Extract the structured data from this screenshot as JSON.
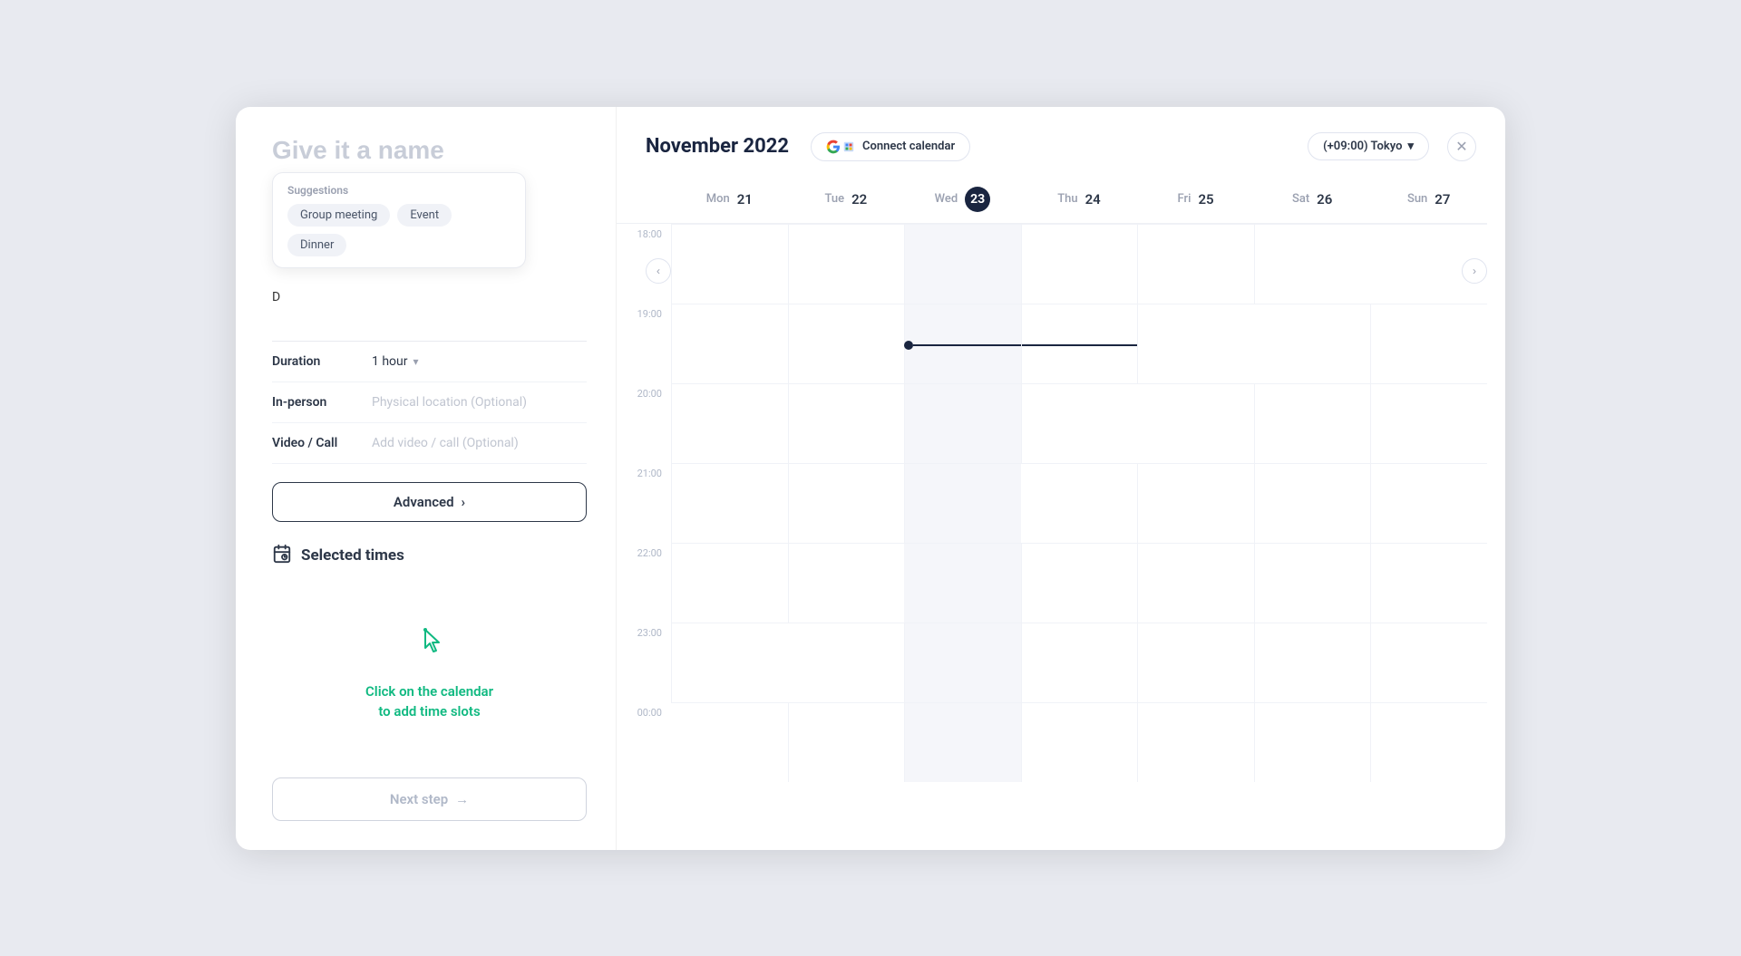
{
  "left": {
    "title_placeholder": "Give it a name",
    "suggestions_label": "Suggestions",
    "chips": [
      "Group meeting",
      "Event",
      "Dinner"
    ],
    "description_placeholder": "D...",
    "fields": [
      {
        "label": "Duration",
        "value": "1 hour",
        "hasChevron": true,
        "hasPlaceholder": false
      },
      {
        "label": "In-person",
        "value": "",
        "hasChevron": false,
        "hasPlaceholder": true,
        "placeholder": "Physical location (Optional)"
      },
      {
        "label": "Video / Call",
        "value": "",
        "hasChevron": false,
        "hasPlaceholder": true,
        "placeholder": "Add video / call (Optional)"
      }
    ],
    "advanced_label": "Advanced",
    "selected_times_title": "Selected times",
    "empty_state_line1": "Click on the calendar",
    "empty_state_line2": "to add time slots",
    "next_step_label": "Next step"
  },
  "header": {
    "month_title": "November 2022",
    "connect_calendar_label": "Connect calendar",
    "timezone_label": "(+09:00) Tokyo"
  },
  "calendar": {
    "days": [
      {
        "name": "Mon",
        "num": "21",
        "today": false
      },
      {
        "name": "Tue",
        "num": "22",
        "today": false
      },
      {
        "name": "Wed",
        "num": "23",
        "today": true
      },
      {
        "name": "Thu",
        "num": "24",
        "today": false
      },
      {
        "name": "Fri",
        "num": "25",
        "today": false
      },
      {
        "name": "Sat",
        "num": "26",
        "today": false
      },
      {
        "name": "Sun",
        "num": "27",
        "today": false
      }
    ],
    "time_slots": [
      "18:00",
      "19:00",
      "20:00",
      "21:00",
      "22:00",
      "23:00",
      "00:00"
    ],
    "indicator_row": 1,
    "indicator_col": 2
  }
}
